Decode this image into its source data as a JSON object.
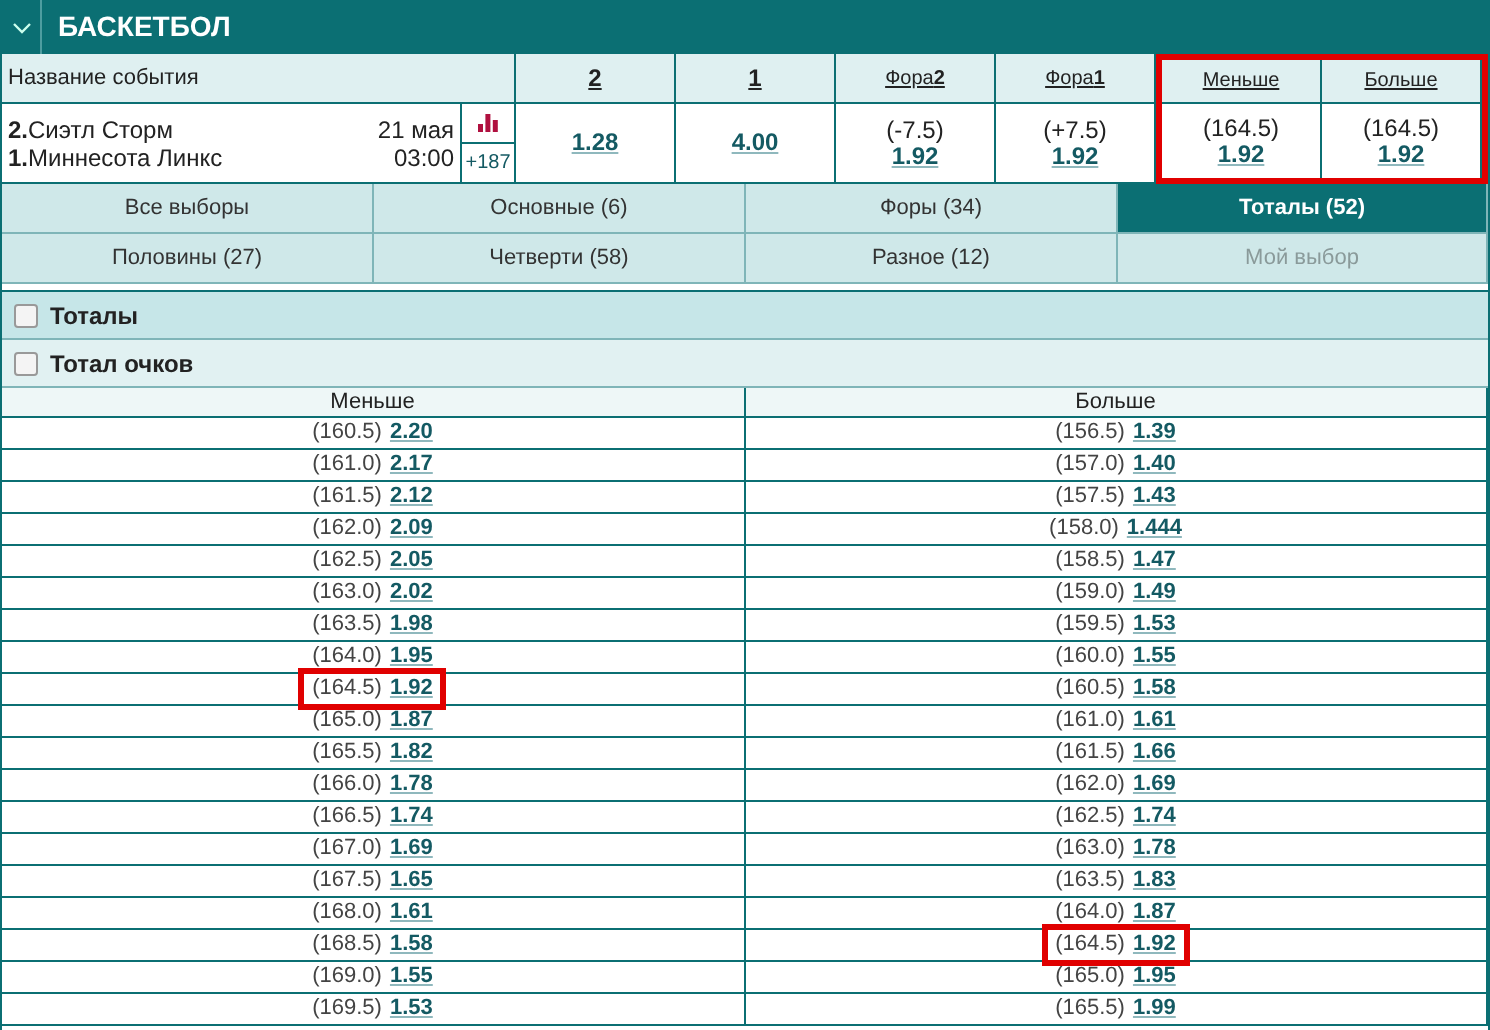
{
  "sport_header": {
    "title": "БАСКЕТБОЛ",
    "expanded": true
  },
  "event_table": {
    "name_column": "Название события",
    "columns": [
      {
        "label": "2",
        "odds": "1.28",
        "highlighted": false
      },
      {
        "label": "1",
        "odds": "4.00",
        "highlighted": false
      },
      {
        "label": "Фора**2**",
        "line": "(-7.5)",
        "odds": "1.92",
        "highlighted": false
      },
      {
        "label": "Фора**1**",
        "line": "(+7.5)",
        "odds": "1.92",
        "highlighted": false
      },
      {
        "label": "Меньше",
        "line": "(164.5)",
        "odds": "1.92",
        "highlighted": true
      },
      {
        "label": "Больше",
        "line": "(164.5)",
        "odds": "1.92",
        "highlighted": true
      }
    ],
    "event": {
      "teams": [
        {
          "number": "2.",
          "name": "Сиэтл Сторм"
        },
        {
          "number": "1.",
          "name": "Миннесота Линкс"
        }
      ],
      "date": "21 мая",
      "time": "03:00",
      "more_count": "+187"
    }
  },
  "market_tabs": [
    {
      "label": "Все выборы",
      "selected": false,
      "disabled": false
    },
    {
      "label": "Основные (6)",
      "selected": false,
      "disabled": false
    },
    {
      "label": "Форы (34)",
      "selected": false,
      "disabled": false
    },
    {
      "label": "Тоталы (52)",
      "selected": true,
      "disabled": false
    },
    {
      "label": "Половины (27)",
      "selected": false,
      "disabled": false
    },
    {
      "label": "Четверти (58)",
      "selected": false,
      "disabled": false
    },
    {
      "label": "Разное (12)",
      "selected": false,
      "disabled": false
    },
    {
      "label": "Мой выбор",
      "selected": false,
      "disabled": true
    }
  ],
  "sections": [
    {
      "title": "Тоталы",
      "checked": false
    },
    {
      "title": "Тотал очков",
      "checked": false
    }
  ],
  "totals_table": {
    "columns": [
      "Меньше",
      "Больше"
    ],
    "rows": [
      [
        {
          "line": "(160.5)",
          "odds": "2.20",
          "highlighted": false
        },
        {
          "line": "(156.5)",
          "odds": "1.39",
          "highlighted": false
        }
      ],
      [
        {
          "line": "(161.0)",
          "odds": "2.17",
          "highlighted": false
        },
        {
          "line": "(157.0)",
          "odds": "1.40",
          "highlighted": false
        }
      ],
      [
        {
          "line": "(161.5)",
          "odds": "2.12",
          "highlighted": false
        },
        {
          "line": "(157.5)",
          "odds": "1.43",
          "highlighted": false
        }
      ],
      [
        {
          "line": "(162.0)",
          "odds": "2.09",
          "highlighted": false
        },
        {
          "line": "(158.0)",
          "odds": "1.444",
          "highlighted": false
        }
      ],
      [
        {
          "line": "(162.5)",
          "odds": "2.05",
          "highlighted": false
        },
        {
          "line": "(158.5)",
          "odds": "1.47",
          "highlighted": false
        }
      ],
      [
        {
          "line": "(163.0)",
          "odds": "2.02",
          "highlighted": false
        },
        {
          "line": "(159.0)",
          "odds": "1.49",
          "highlighted": false
        }
      ],
      [
        {
          "line": "(163.5)",
          "odds": "1.98",
          "highlighted": false
        },
        {
          "line": "(159.5)",
          "odds": "1.53",
          "highlighted": false
        }
      ],
      [
        {
          "line": "(164.0)",
          "odds": "1.95",
          "highlighted": false
        },
        {
          "line": "(160.0)",
          "odds": "1.55",
          "highlighted": false
        }
      ],
      [
        {
          "line": "(164.5)",
          "odds": "1.92",
          "highlighted": true
        },
        {
          "line": "(160.5)",
          "odds": "1.58",
          "highlighted": false
        }
      ],
      [
        {
          "line": "(165.0)",
          "odds": "1.87",
          "highlighted": false
        },
        {
          "line": "(161.0)",
          "odds": "1.61",
          "highlighted": false
        }
      ],
      [
        {
          "line": "(165.5)",
          "odds": "1.82",
          "highlighted": false
        },
        {
          "line": "(161.5)",
          "odds": "1.66",
          "highlighted": false
        }
      ],
      [
        {
          "line": "(166.0)",
          "odds": "1.78",
          "highlighted": false
        },
        {
          "line": "(162.0)",
          "odds": "1.69",
          "highlighted": false
        }
      ],
      [
        {
          "line": "(166.5)",
          "odds": "1.74",
          "highlighted": false
        },
        {
          "line": "(162.5)",
          "odds": "1.74",
          "highlighted": false
        }
      ],
      [
        {
          "line": "(167.0)",
          "odds": "1.69",
          "highlighted": false
        },
        {
          "line": "(163.0)",
          "odds": "1.78",
          "highlighted": false
        }
      ],
      [
        {
          "line": "(167.5)",
          "odds": "1.65",
          "highlighted": false
        },
        {
          "line": "(163.5)",
          "odds": "1.83",
          "highlighted": false
        }
      ],
      [
        {
          "line": "(168.0)",
          "odds": "1.61",
          "highlighted": false
        },
        {
          "line": "(164.0)",
          "odds": "1.87",
          "highlighted": false
        }
      ],
      [
        {
          "line": "(168.5)",
          "odds": "1.58",
          "highlighted": false
        },
        {
          "line": "(164.5)",
          "odds": "1.92",
          "highlighted": true
        }
      ],
      [
        {
          "line": "(169.0)",
          "odds": "1.55",
          "highlighted": false
        },
        {
          "line": "(165.0)",
          "odds": "1.95",
          "highlighted": false
        }
      ],
      [
        {
          "line": "(169.5)",
          "odds": "1.53",
          "highlighted": false
        },
        {
          "line": "(165.5)",
          "odds": "1.99",
          "highlighted": false
        }
      ]
    ]
  }
}
